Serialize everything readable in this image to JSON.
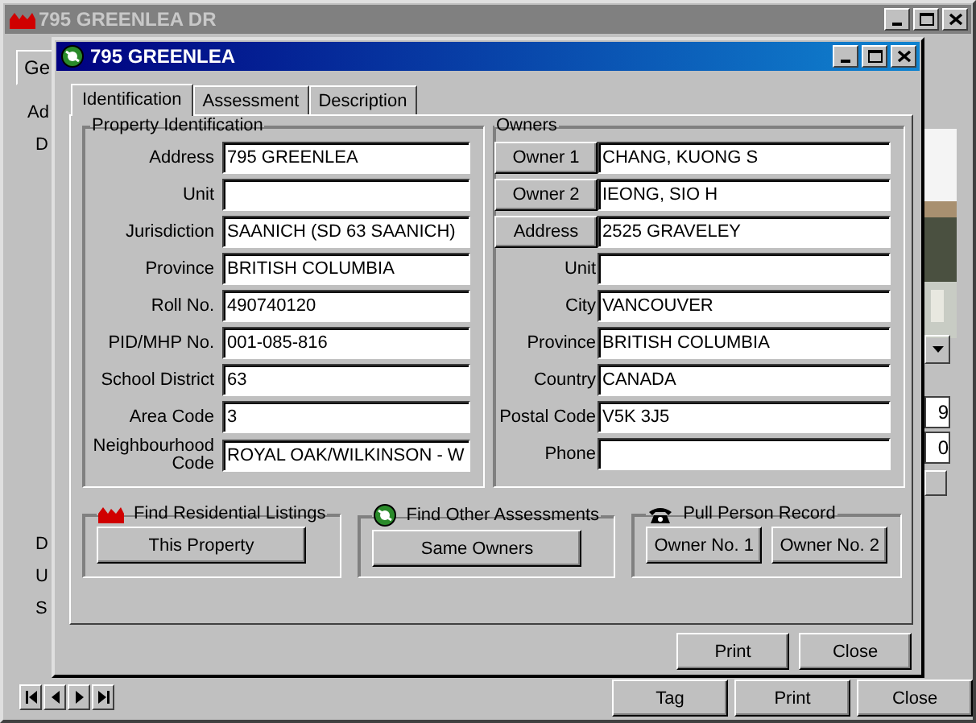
{
  "background_window": {
    "title": "795 GREENLEA DR",
    "tab": "Ge",
    "labels": [
      "Ad",
      "D"
    ],
    "lower_labels": [
      "D",
      "U",
      "S"
    ],
    "side_fields": [
      "9",
      "0"
    ],
    "buttons": [
      "Tag",
      "Print",
      "Close"
    ]
  },
  "dialog": {
    "title": "795 GREENLEA",
    "tabs": [
      {
        "label": "Identification",
        "selected": true
      },
      {
        "label": "Assessment",
        "selected": false
      },
      {
        "label": "Description",
        "selected": false
      }
    ],
    "property_identification": {
      "title": "Property Identification",
      "fields": [
        {
          "label": "Address",
          "value": "795 GREENLEA"
        },
        {
          "label": "Unit"
        },
        {
          "label": "Jurisdiction",
          "value": "SAANICH (SD 63 SAANICH)"
        },
        {
          "label": "Province",
          "value": "BRITISH COLUMBIA"
        },
        {
          "label": "Roll No.",
          "value": "490740120"
        },
        {
          "label": "PID/MHP No.",
          "value": "001-085-816"
        },
        {
          "label": "School District",
          "value": "63"
        },
        {
          "label": "Area Code",
          "value": "3"
        },
        {
          "label": "Neighbourhood Code",
          "value": "ROYAL OAK/WILKINSON - W"
        }
      ]
    },
    "owners": {
      "title": "Owners",
      "fields": [
        {
          "kind": "button",
          "label": "Owner 1",
          "value": "CHANG, KUONG S"
        },
        {
          "kind": "button",
          "label": "Owner 2",
          "value": "IEONG, SIO H"
        },
        {
          "kind": "button",
          "label": "Address",
          "value": "2525 GRAVELEY"
        },
        {
          "kind": "label",
          "label": "Unit"
        },
        {
          "kind": "label",
          "label": "City",
          "value": "VANCOUVER"
        },
        {
          "kind": "label",
          "label": "Province",
          "value": "BRITISH COLUMBIA"
        },
        {
          "kind": "label",
          "label": "Country",
          "value": "CANADA"
        },
        {
          "kind": "label",
          "label": "Postal Code",
          "value": "V5K 3J5"
        },
        {
          "kind": "label",
          "label": "Phone"
        }
      ]
    },
    "actions": [
      {
        "kind": "houses",
        "title": "Find Residential Listings",
        "buttons": [
          "This Property"
        ]
      },
      {
        "kind": "disc",
        "title": "Find Other Assessments",
        "buttons": [
          "Same Owners"
        ]
      },
      {
        "kind": "phone",
        "title": "Pull Person Record",
        "buttons": [
          "Owner No. 1",
          "Owner No. 2"
        ]
      }
    ],
    "buttons": [
      "Print",
      "Close"
    ]
  }
}
